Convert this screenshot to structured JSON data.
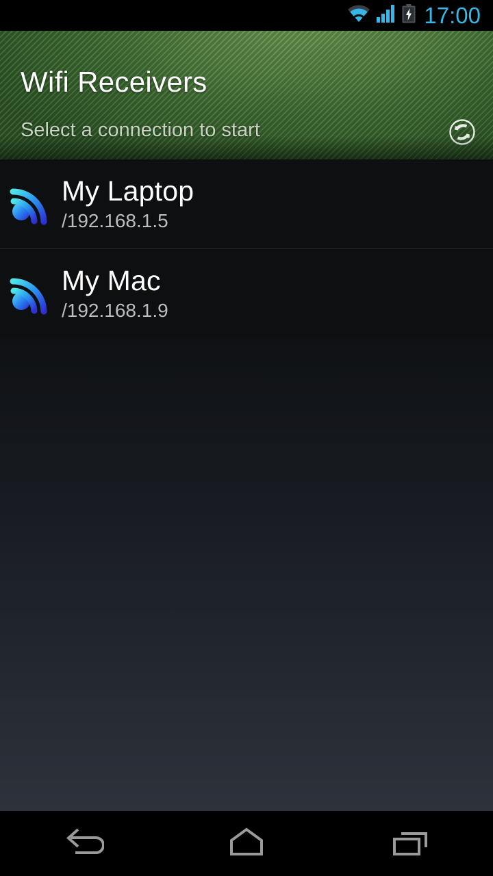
{
  "status_bar": {
    "clock": "17:00",
    "clock_color": "#37b6e8",
    "icons": [
      "wifi-icon",
      "cellular-signal-icon",
      "battery-charging-icon"
    ]
  },
  "header": {
    "title": "Wifi Receivers",
    "subtitle": "Select a connection to start",
    "refresh_icon": "refresh-icon",
    "accent_color": "#3d6b31"
  },
  "receivers": [
    {
      "name": "My Laptop",
      "address": "/192.168.1.5",
      "icon": "wifi-broadcast-icon"
    },
    {
      "name": "My Mac",
      "address": "/192.168.1.9",
      "icon": "wifi-broadcast-icon"
    }
  ],
  "nav_bar": {
    "back_label": "Back",
    "home_label": "Home",
    "recents_label": "Recent apps"
  }
}
